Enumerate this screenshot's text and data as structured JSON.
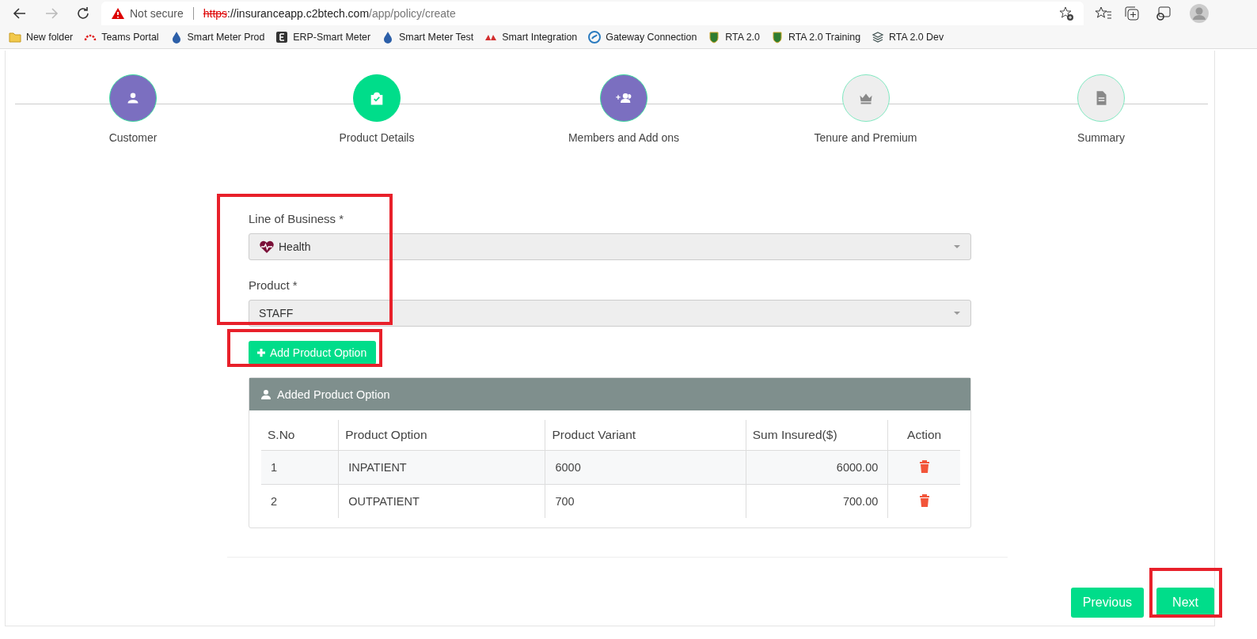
{
  "browser": {
    "security": "Not secure",
    "url_scheme": "https",
    "url_host": "://insuranceapp.c2btech.com",
    "url_path": "/app/policy/create",
    "bookmarks": [
      "New folder",
      "Teams Portal",
      "Smart Meter Prod",
      "ERP-Smart Meter",
      "Smart Meter Test",
      "Smart Integration",
      "Gateway Connection",
      "RTA 2.0",
      "RTA 2.0 Training",
      "RTA 2.0 Dev"
    ]
  },
  "steps": [
    {
      "label": "Customer",
      "completed": true,
      "selected": false
    },
    {
      "label": "Product Details",
      "completed": false,
      "selected": true
    },
    {
      "label": "Members and Add ons",
      "completed": true,
      "selected": false
    },
    {
      "label": "Tenure and Premium",
      "completed": false,
      "selected": false
    },
    {
      "label": "Summary",
      "completed": false,
      "selected": false
    }
  ],
  "form": {
    "fields": [
      {
        "label": "Line of Business *",
        "value": "Health",
        "kind": "icon-select"
      },
      {
        "label": "Product *",
        "value": "STAFF",
        "kind": "select"
      }
    ],
    "add_button": "Add Product Option"
  },
  "options_panel": {
    "title": "Added Product Option",
    "columns": [
      "S.No",
      "Product Option",
      "Product Variant",
      "Sum Insured($)",
      "Action"
    ],
    "rows": [
      {
        "sno": "1",
        "option": "INPATIENT",
        "variant": "6000",
        "sum": "6000.00"
      },
      {
        "sno": "2",
        "option": "OUTPATIENT",
        "variant": "700",
        "sum": "700.00"
      }
    ]
  },
  "nav": {
    "previous": "Previous",
    "next": "Next"
  }
}
